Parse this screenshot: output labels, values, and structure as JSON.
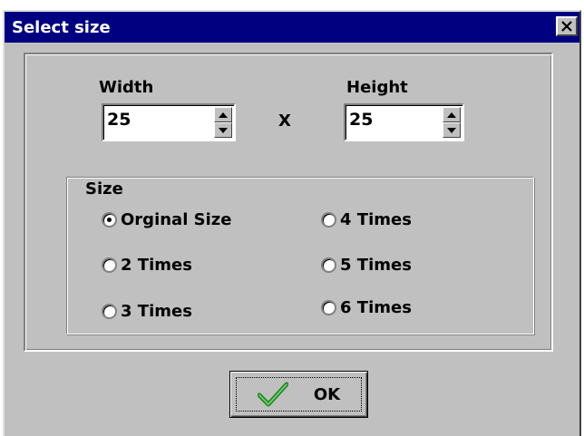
{
  "window": {
    "title": "Select size",
    "close_glyph": "✕"
  },
  "width": {
    "label": "Width",
    "value": "25"
  },
  "height": {
    "label": "Height",
    "value": "25"
  },
  "separator": "X",
  "size_group": {
    "legend": "Size",
    "options": [
      {
        "label": "Orginal Size",
        "checked": true
      },
      {
        "label": "2 Times",
        "checked": false
      },
      {
        "label": "3 Times",
        "checked": false
      },
      {
        "label": "4 Times",
        "checked": false
      },
      {
        "label": "5 Times",
        "checked": false
      },
      {
        "label": "6 Times",
        "checked": false
      }
    ]
  },
  "ok_button": {
    "label": "OK",
    "icon": "checkmark-icon",
    "icon_color": "#1f8a1f"
  },
  "colors": {
    "titlebar": "#000080",
    "face": "#c0c0c0"
  }
}
